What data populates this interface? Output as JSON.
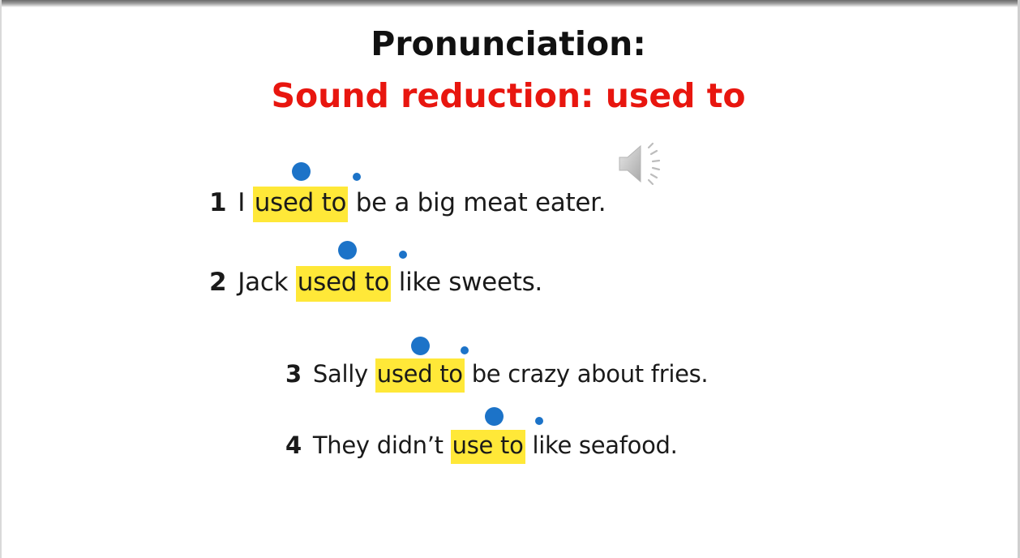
{
  "slide": {
    "title": "Pronunciation:",
    "subtitle": "Sound reduction: used to",
    "accent_color": "#e8160f",
    "highlight_color": "#ffe838",
    "stress_dot_color": "#1c73c8",
    "speaker_icon": "speaker-icon"
  },
  "sentences": [
    {
      "number": "1",
      "before": "I",
      "highlight": "used to",
      "after": "be a big meat eater."
    },
    {
      "number": "2",
      "before": "Jack",
      "highlight": "used to",
      "after": "like sweets."
    },
    {
      "number": "3",
      "before": "Sally",
      "highlight": "used to",
      "after": "be crazy about fries."
    },
    {
      "number": "4",
      "before": "They didn’t",
      "highlight": "use to",
      "after": "like seafood."
    }
  ]
}
